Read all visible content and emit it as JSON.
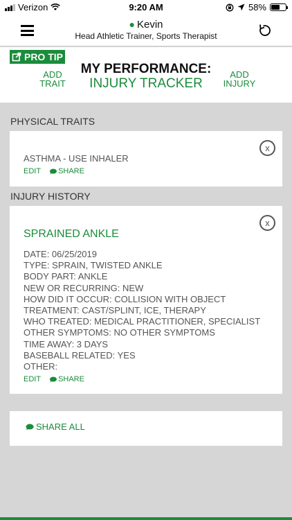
{
  "status_bar": {
    "carrier": "Verizon",
    "time": "9:20 AM",
    "battery": "58%",
    "battery_level": 0.58
  },
  "header": {
    "user_name": "Kevin",
    "user_role": "Head Athletic Trainer, Sports Therapist",
    "menu_icon": "hamburger-menu-icon",
    "refresh_icon": "refresh-icon"
  },
  "toolbar": {
    "pro_tip_label": "PRO TIP",
    "add_trait_line1": "ADD",
    "add_trait_line2": "TRAIT",
    "title_line1": "MY PERFORMANCE:",
    "title_line2": "INJURY TRACKER",
    "add_injury_line1": "ADD",
    "add_injury_line2": "INJURY"
  },
  "physical_traits": {
    "section_label": "PHYSICAL TRAITS",
    "items": [
      {
        "text": "ASTHMA - USE INHALER",
        "edit_label": "EDIT",
        "share_label": "SHARE",
        "close_label": "x"
      }
    ]
  },
  "injury_history": {
    "section_label": "INJURY HISTORY",
    "items": [
      {
        "title": "SPRAINED ANKLE",
        "close_label": "x",
        "details": [
          "DATE: 06/25/2019",
          "TYPE: SPRAIN, TWISTED ANKLE",
          "BODY PART: ANKLE",
          "NEW OR RECURRING: NEW",
          "HOW DID IT OCCUR: COLLISION WITH OBJECT",
          "TREATMENT: CAST/SPLINT, ICE, THERAPY",
          "WHO TREATED: MEDICAL PRACTITIONER, SPECIALIST",
          "OTHER SYMPTOMS: NO OTHER SYMPTOMS",
          "TIME AWAY: 3 DAYS",
          "BASEBALL RELATED: YES",
          "OTHER:"
        ],
        "edit_label": "EDIT",
        "share_label": "SHARE"
      }
    ]
  },
  "share_all_label": "SHARE ALL",
  "colors": {
    "accent": "#1a8c3c",
    "background": "#d6d6d6"
  }
}
